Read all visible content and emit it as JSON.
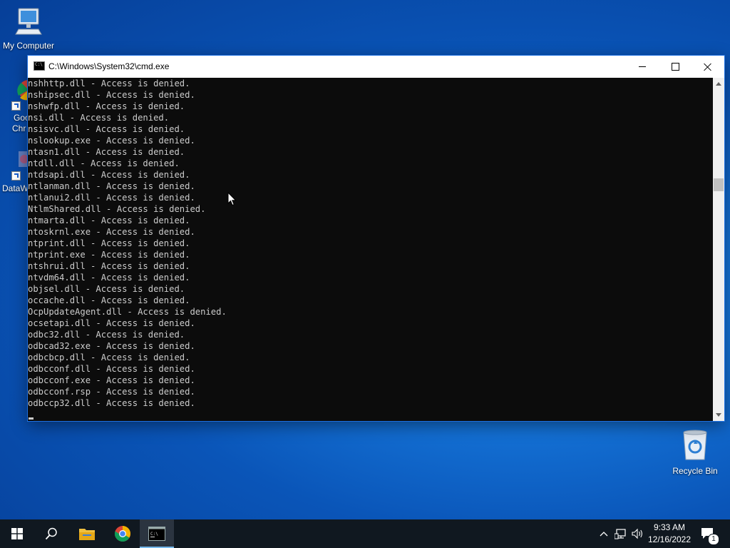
{
  "desktop": {
    "my_computer_label": "My Computer",
    "chrome_label_partial_1": "Goo",
    "chrome_label_partial_2": "Chr",
    "dataw_label_partial": "DataW",
    "recycle_bin_label": "Recycle Bin"
  },
  "window": {
    "title": "C:\\Windows\\System32\\cmd.exe",
    "console_lines": [
      "nshhttp.dll - Access is denied.",
      "nshipsec.dll - Access is denied.",
      "nshwfp.dll - Access is denied.",
      "nsi.dll - Access is denied.",
      "nsisvc.dll - Access is denied.",
      "nslookup.exe - Access is denied.",
      "ntasn1.dll - Access is denied.",
      "ntdll.dll - Access is denied.",
      "ntdsapi.dll - Access is denied.",
      "ntlanman.dll - Access is denied.",
      "ntlanui2.dll - Access is denied.",
      "NtlmShared.dll - Access is denied.",
      "ntmarta.dll - Access is denied.",
      "ntoskrnl.exe - Access is denied.",
      "ntprint.dll - Access is denied.",
      "ntprint.exe - Access is denied.",
      "ntshrui.dll - Access is denied.",
      "ntvdm64.dll - Access is denied.",
      "objsel.dll - Access is denied.",
      "occache.dll - Access is denied.",
      "OcpUpdateAgent.dll - Access is denied.",
      "ocsetapi.dll - Access is denied.",
      "odbc32.dll - Access is denied.",
      "odbcad32.exe - Access is denied.",
      "odbcbcp.dll - Access is denied.",
      "odbcconf.dll - Access is denied.",
      "odbcconf.exe - Access is denied.",
      "odbcconf.rsp - Access is denied.",
      "odbccp32.dll - Access is denied."
    ]
  },
  "taskbar": {
    "items": [
      "start-icon",
      "search-icon",
      "file-explorer-icon",
      "chrome-icon",
      "cmd-icon"
    ],
    "clock_time": "9:33 AM",
    "clock_date": "12/16/2022",
    "notification_count": "1"
  },
  "colors": {
    "console_bg": "#0c0c0c",
    "console_fg": "#cccccc",
    "taskbar_bg": "#101820",
    "accent": "#76b9ed"
  }
}
